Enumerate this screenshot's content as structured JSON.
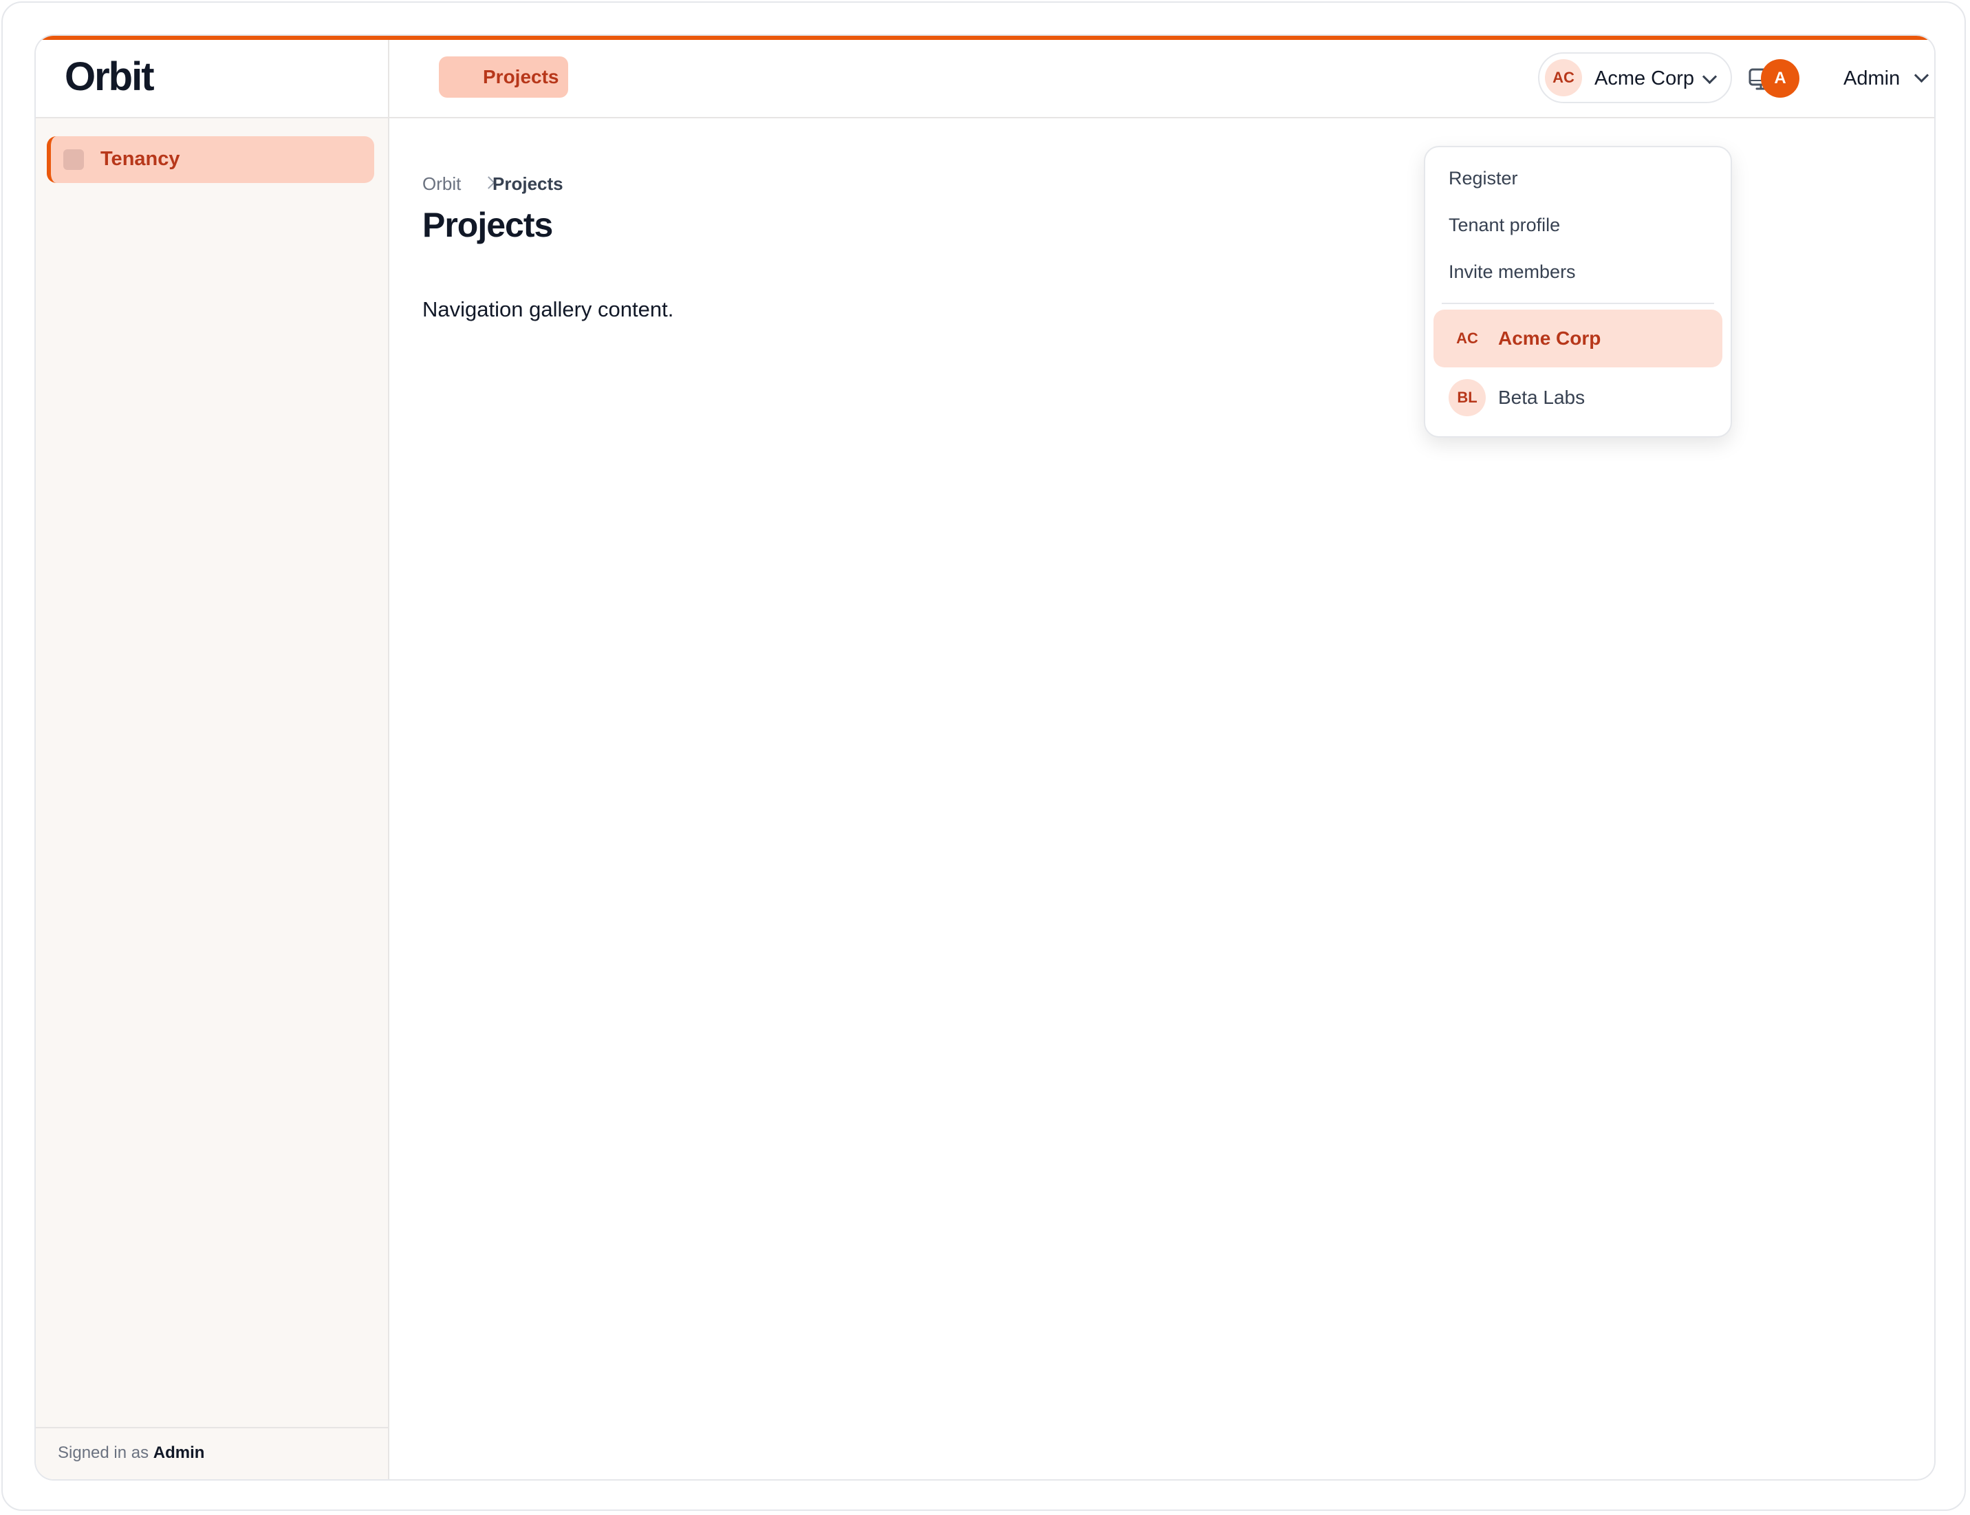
{
  "app": {
    "brand": "Orbit"
  },
  "sidebar": {
    "items": [
      {
        "label": "Tenancy",
        "active": true
      }
    ],
    "footer": {
      "prefix": "Signed in as",
      "user": "Admin"
    }
  },
  "header": {
    "tabs": [
      {
        "label": "Projects",
        "active": true
      }
    ],
    "tenant_switcher": {
      "initials": "AC",
      "name": "Acme Corp"
    },
    "monitor_icon": "monitor-icon",
    "user": {
      "initial": "A",
      "name": "Admin"
    }
  },
  "breadcrumb": {
    "root": "Orbit",
    "current": "Projects"
  },
  "page": {
    "title": "Projects",
    "body": "Navigation gallery content."
  },
  "dropdown": {
    "actions": [
      "Register",
      "Tenant profile",
      "Invite members"
    ],
    "tenants": [
      {
        "initials": "AC",
        "name": "Acme Corp",
        "active": true
      },
      {
        "initials": "BL",
        "name": "Beta Labs",
        "active": false
      }
    ]
  },
  "colors": {
    "accent": "#ea580c",
    "accent_soft": "#fcd0c1",
    "accent_text": "#b7371a"
  }
}
